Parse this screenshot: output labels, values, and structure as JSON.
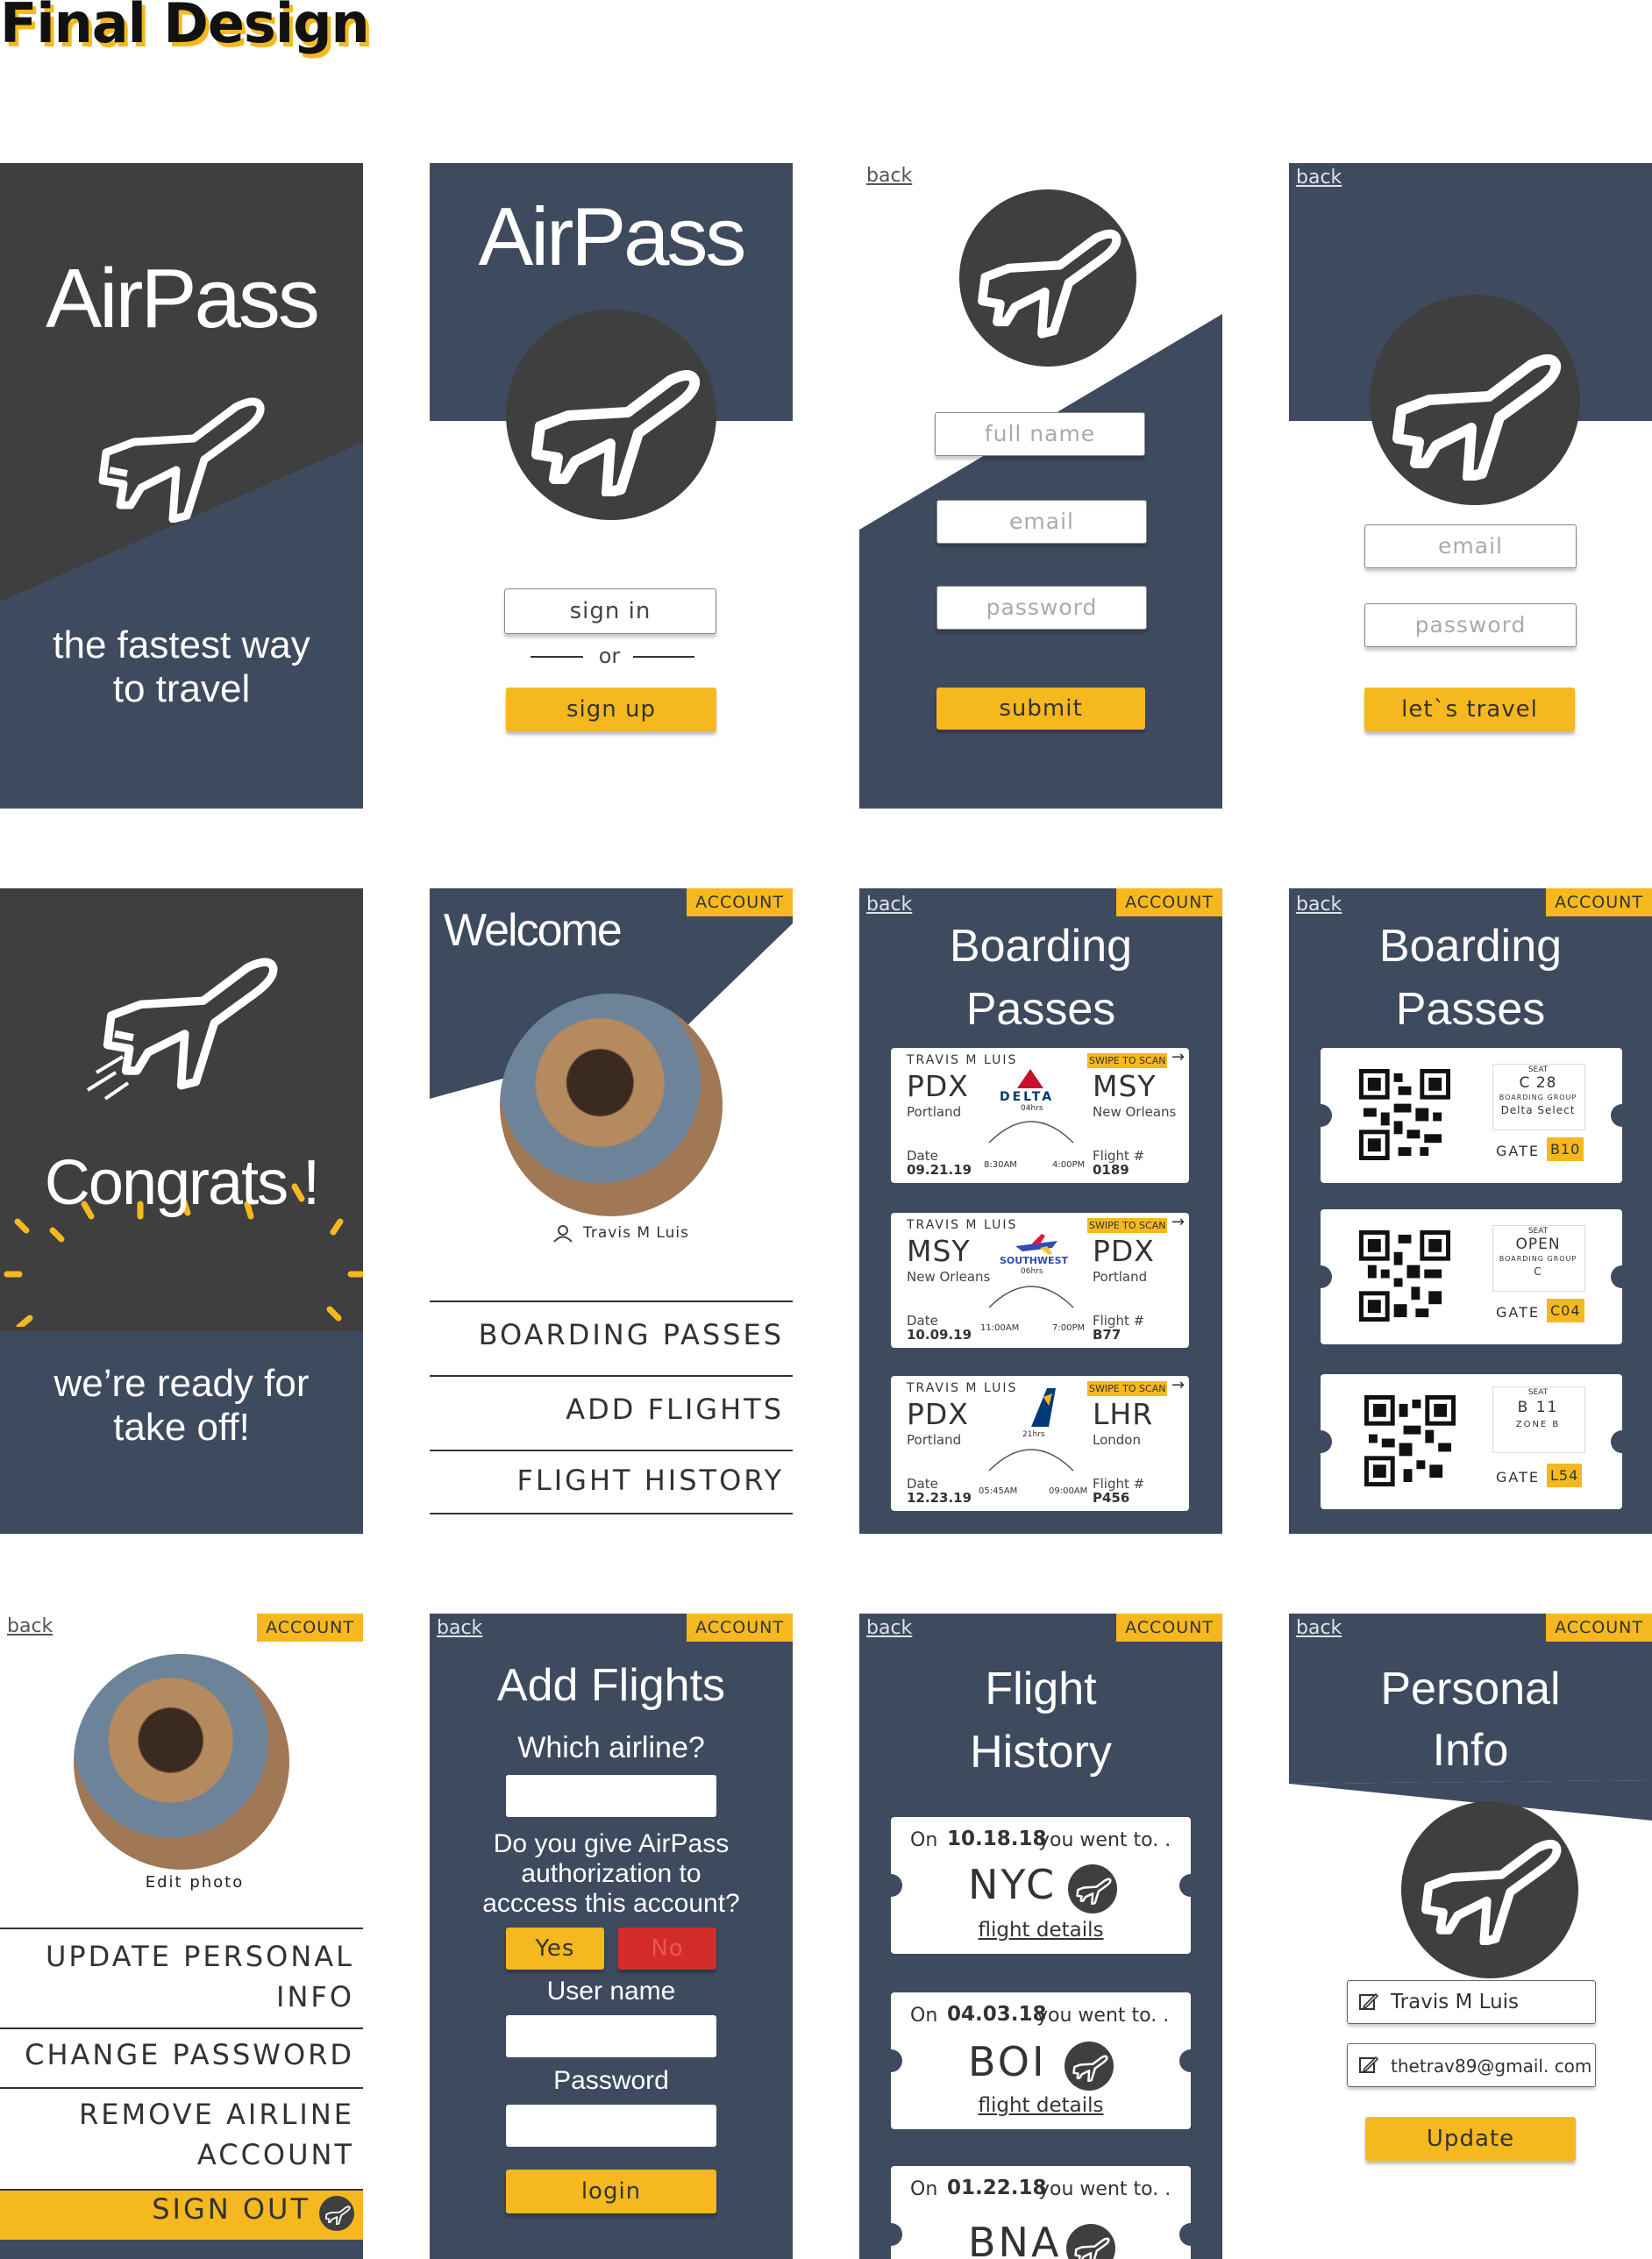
{
  "page_title": "Final Design",
  "colors": {
    "navy": "#3e4a5e",
    "charcoal": "#3f3f3f",
    "yellow": "#f5b81e",
    "red": "#d42b2b"
  },
  "common": {
    "back": "back",
    "account": "ACCOUNT"
  },
  "splash": {
    "brand": "AirPass",
    "tagline_1": "the fastest way",
    "tagline_2": "to travel"
  },
  "landing": {
    "brand": "AirPass",
    "sign_in": "sign in",
    "or": "or",
    "sign_up": "sign up"
  },
  "signup": {
    "full_name": "full name",
    "email": "email",
    "password": "password",
    "submit": "submit"
  },
  "login": {
    "email": "email",
    "password": "password",
    "lets_travel": "let`s travel"
  },
  "congrats": {
    "headline": "Congrats !",
    "line1": "we’re ready for",
    "line2": "take off!"
  },
  "welcome": {
    "title": "Welcome",
    "user": "Travis M Luis",
    "menu": [
      "BOARDING PASSES",
      "ADD FLIGHTS",
      "FLIGHT HISTORY"
    ]
  },
  "passes": {
    "title_1": "Boarding",
    "title_2": "Passes",
    "swipe": "SWIPE TO SCAN",
    "items": [
      {
        "name": "TRAVIS M LUIS",
        "from": "PDX",
        "from_city": "Portland",
        "to": "MSY",
        "to_city": "New Orleans",
        "airline": "DELTA",
        "duration": "04hrs",
        "date_label": "Date",
        "date": "09.21.19",
        "dep": "8:30AM",
        "arr": "4:00PM",
        "flight_label": "Flight #",
        "flight": "0189"
      },
      {
        "name": "TRAVIS M LUIS",
        "from": "MSY",
        "from_city": "New Orleans",
        "to": "PDX",
        "to_city": "Portland",
        "airline": "SOUTHWEST",
        "duration": "06hrs",
        "date_label": "Date",
        "date": "10.09.19",
        "dep": "11:00AM",
        "arr": "7:00PM",
        "flight_label": "Flight #",
        "flight": "B77"
      },
      {
        "name": "TRAVIS M LUIS",
        "from": "PDX",
        "from_city": "Portland",
        "to": "LHR",
        "to_city": "London",
        "airline": "ICELANDAIR",
        "duration": "21hrs",
        "date_label": "Date",
        "date": "12.23.19",
        "dep": "05:45AM",
        "arr": "09:00AM",
        "flight_label": "Flight #",
        "flight": "P456"
      }
    ]
  },
  "scans": {
    "title_1": "Boarding",
    "title_2": "Passes",
    "items": [
      {
        "seat_label": "SEAT",
        "seat": "C 28",
        "group_label": "BOARDING GROUP",
        "group": "Delta Select",
        "gate_label": "GATE",
        "gate": "B10"
      },
      {
        "seat_label": "SEAT",
        "seat": "OPEN",
        "group_label": "BOARDING GROUP",
        "group": "C",
        "gate_label": "GATE",
        "gate": "C04"
      },
      {
        "seat_label": "SEAT",
        "seat": "B 11",
        "group_label": "ZONE B",
        "group": "",
        "gate_label": "GATE",
        "gate": "L54"
      }
    ]
  },
  "account": {
    "edit_photo": "Edit photo",
    "update_1": "UPDATE PERSONAL",
    "update_2": "INFO",
    "change_password": "CHANGE PASSWORD",
    "remove_1": "REMOVE AIRLINE",
    "remove_2": "ACCOUNT",
    "sign_out": "SIGN OUT"
  },
  "add_flights": {
    "title": "Add Flights",
    "which": "Which airline?",
    "auth_1": "Do you give AirPass",
    "auth_2": "authorization to",
    "auth_3": "acccess this account?",
    "yes": "Yes",
    "no": "No",
    "username": "User name",
    "password": "Password",
    "login": "login"
  },
  "history": {
    "title_1": "Flight",
    "title_2": "History",
    "details": "flight details",
    "items": [
      {
        "on": "On",
        "date": "10.18.18",
        "went": "you went to. .",
        "code": "NYC"
      },
      {
        "on": "On",
        "date": "04.03.18",
        "went": "you went to. .",
        "code": "BOI"
      },
      {
        "on": "On",
        "date": "01.22.18",
        "went": "you went to. .",
        "code": "BNA"
      }
    ]
  },
  "personal": {
    "title_1": "Personal",
    "title_2": "Info",
    "name": "Travis M Luis",
    "email": "thetrav89@gmail. com",
    "update": "Update"
  }
}
